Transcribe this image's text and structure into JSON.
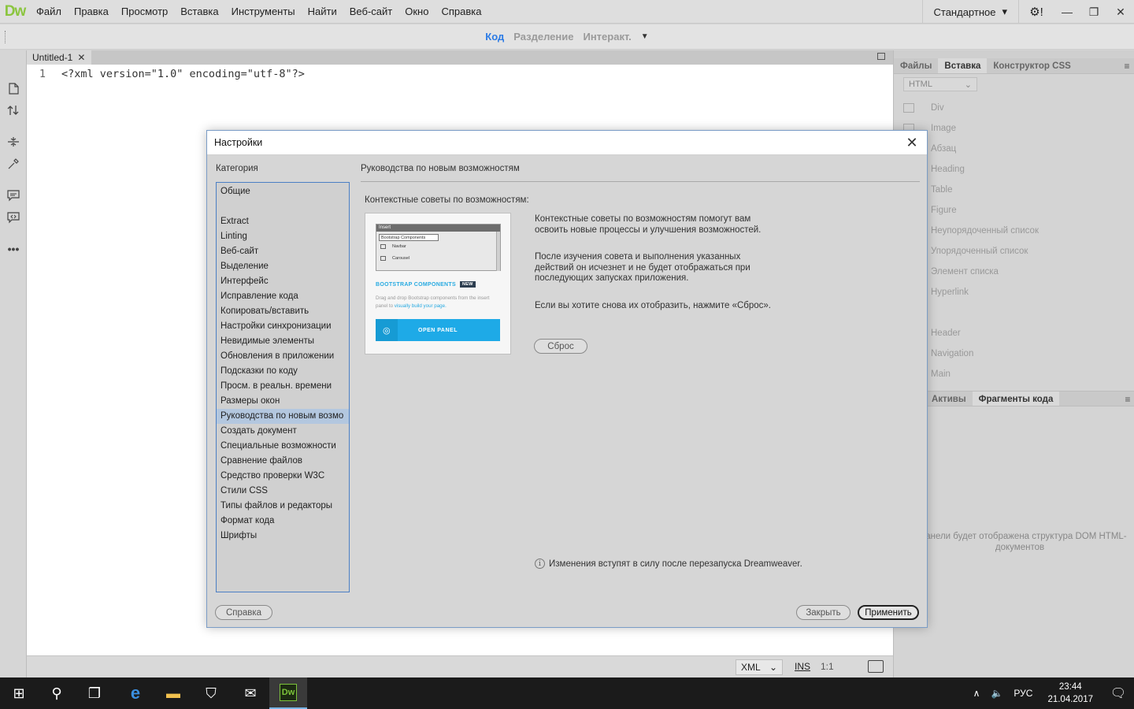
{
  "app": {
    "logo": "Dw",
    "menu": [
      "Файл",
      "Правка",
      "Просмотр",
      "Вставка",
      "Инструменты",
      "Найти",
      "Веб-сайт",
      "Окно",
      "Справка"
    ],
    "workspace": "Стандартное",
    "workspace_caret": "▾",
    "gear": "⚙!",
    "win_min": "—",
    "win_restore": "❐",
    "win_close": "✕"
  },
  "viewbar": {
    "tabs": [
      {
        "label": "Код",
        "active": true
      },
      {
        "label": "Разделение",
        "active": false
      },
      {
        "label": "Интеракт.",
        "active": false
      }
    ],
    "caret": "▼"
  },
  "document": {
    "tab_label": "Untitled-1",
    "tab_close": "✕",
    "lines": [
      {
        "num": "1",
        "code": "<?xml version=\"1.0\" encoding=\"utf-8\"?>"
      }
    ]
  },
  "statusbar": {
    "doc_type": "XML",
    "doc_type_caret": "⌄",
    "insert_mode": "INS",
    "cursor_pos": "1:1"
  },
  "right_panel": {
    "tabs": [
      "Файлы",
      "Вставка",
      "Конструктор CSS"
    ],
    "active_tab": "Вставка",
    "menu_icon": "≡",
    "category": "HTML",
    "category_caret": "⌄",
    "items_group1": [
      "Div",
      "Image",
      "Абзац",
      "Heading",
      "Table",
      "Figure",
      "Неупорядоченный список",
      "Упорядоченный список",
      "Элемент списка",
      "Hyperlink"
    ],
    "items_group2": [
      "Header",
      "Navigation",
      "Main"
    ],
    "bottom_tabs": [
      "Активы",
      "Фрагменты кода"
    ],
    "dom_message": "й панели будет отображена структура DOM HTML-документов"
  },
  "dialog": {
    "title": "Настройки",
    "close": "✕",
    "category_label": "Категория",
    "categories": [
      "Общие",
      "",
      "Extract",
      "Linting",
      "Веб-сайт",
      "Выделение",
      "Интерфейс",
      "Исправление кода",
      "Копировать/вставить",
      "Настройки синхронизации",
      "Невидимые элементы",
      "Обновления в приложении",
      "Подсказки по коду",
      "Просм. в реальн. времени",
      "Размеры окон",
      "Руководства по новым возмо",
      "Создать документ",
      "Специальные возможности",
      "Сравнение файлов",
      "Средство проверки W3C",
      "Стили CSS",
      "Типы файлов и редакторы",
      "Формат кода",
      "Шрифты"
    ],
    "selected_category": "Руководства по новым возмо",
    "section_title": "Руководства по новым возможностям",
    "tips_label": "Контекстные советы по возможностям:",
    "preview": {
      "panel_header": "Insert",
      "dropdown": "Bootstrap Components",
      "rows": [
        "Navbar",
        "Carousel"
      ],
      "title": "BOOTSTRAP COMPONENTS",
      "badge": "NEW",
      "desc_plain": "Drag and drop Bootstrap components from the insert panel to ",
      "desc_link": "visually build your page.",
      "button": "OPEN PANEL"
    },
    "paragraphs": [
      "Контекстные советы по возможностям помогут вам освоить новые процессы и улучшения возможностей.",
      "После изучения совета и выполнения указанных действий он исчезнет и не будет отображаться при последующих запусках приложения.",
      "Если вы хотите снова их отобразить, нажмите «Сброс»."
    ],
    "reset_label": "Сброс",
    "info_icon": "i",
    "info_text": "Изменения вступят в силу после перезапуска Dreamweaver.",
    "help_label": "Справка",
    "close_label": "Закрыть",
    "apply_label": "Применить"
  },
  "taskbar": {
    "start_icon": "⊞",
    "search_icon": "⚲",
    "taskview_icon": "❐",
    "edge_icon": "e",
    "explorer_icon": "▬",
    "store_icon": "⛉",
    "mail_icon": "✉",
    "dw_icon": "Dw",
    "tray_chevron": "∧",
    "volume": "🔈",
    "lang": "РУС",
    "time": "23:44",
    "date": "21.04.2017",
    "notifications": "🗨"
  }
}
